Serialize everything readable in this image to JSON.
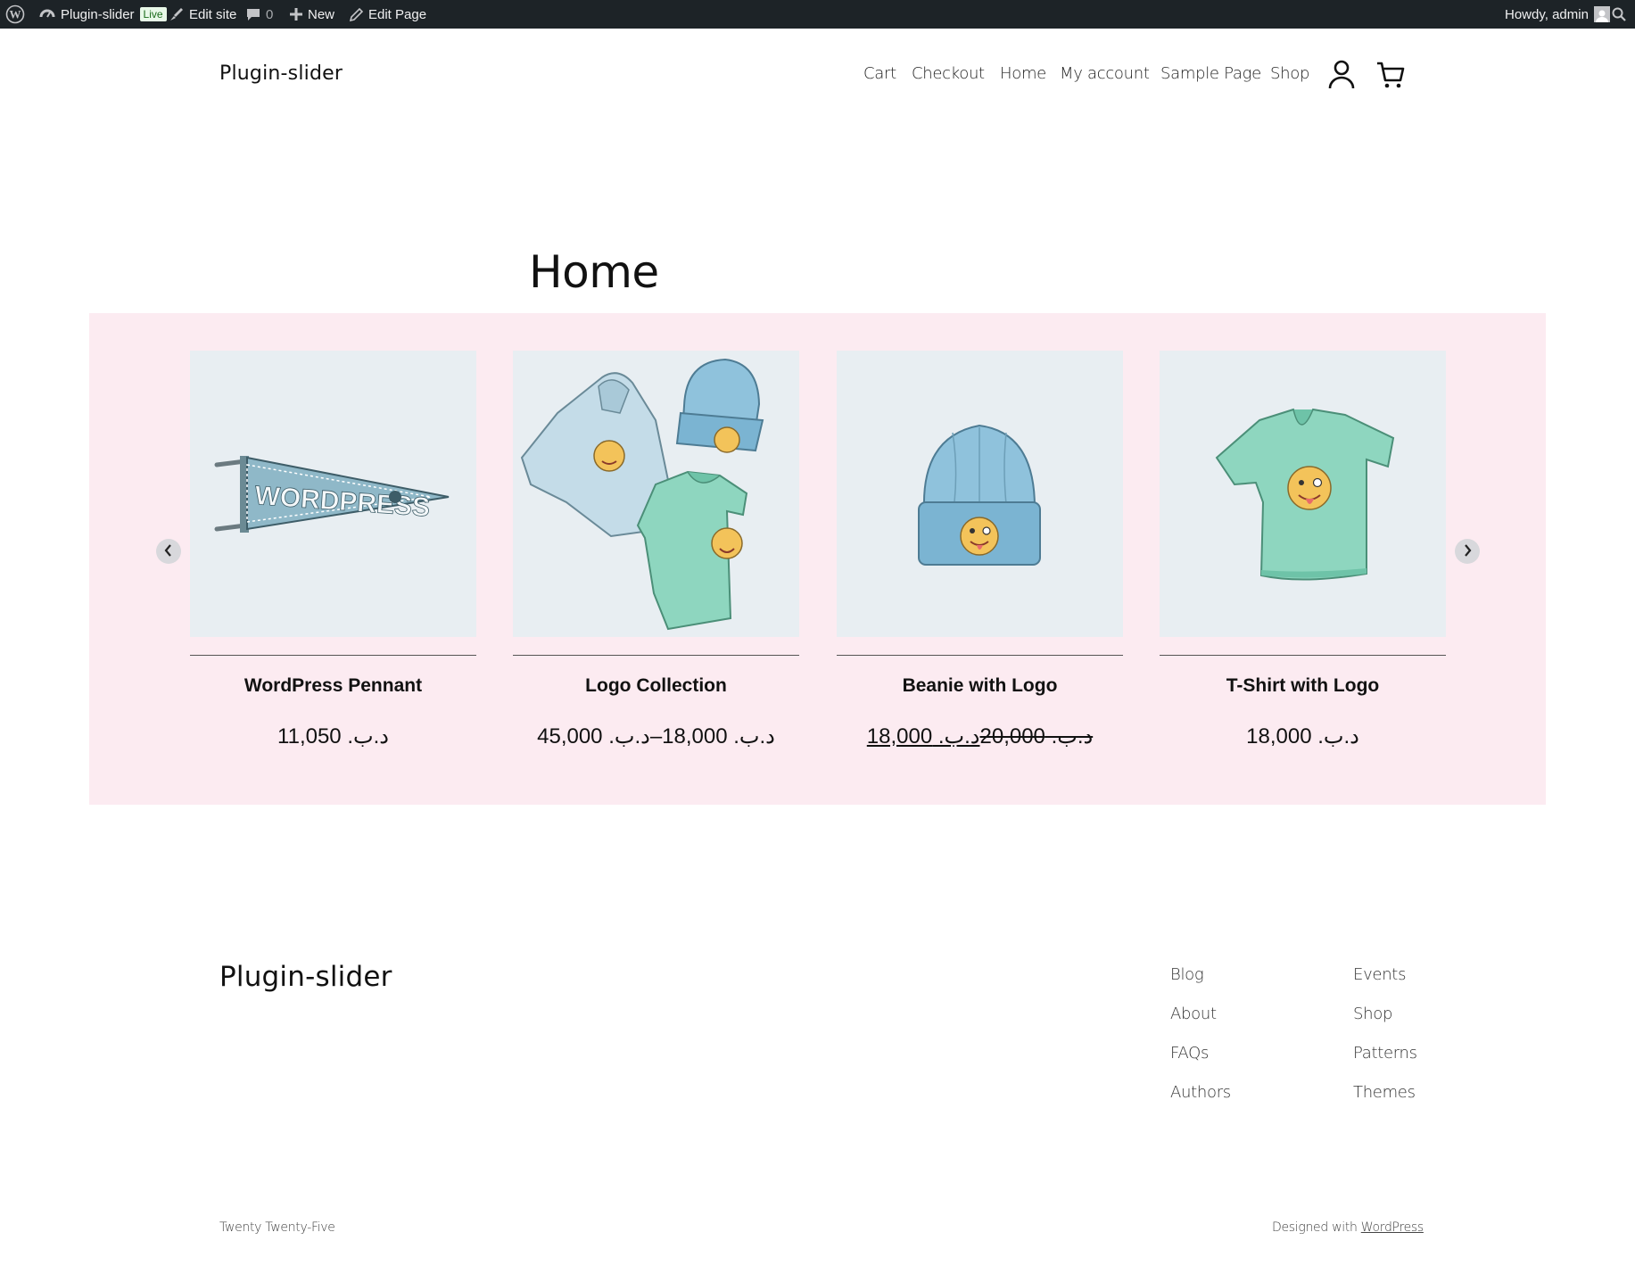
{
  "admin_bar": {
    "site_name": "Plugin-slider",
    "live_badge": "Live",
    "edit_site": "Edit site",
    "comments_count": "0",
    "new_label": "New",
    "edit_page": "Edit Page",
    "howdy": "Howdy, admin"
  },
  "header": {
    "site_title": "Plugin-slider",
    "nav": [
      "Cart",
      "Checkout",
      "Home",
      "My account",
      "Sample Page",
      "Shop"
    ]
  },
  "page": {
    "title": "Home"
  },
  "slider": {
    "background": "#fcebf1",
    "products": [
      {
        "name": "WordPress Pennant",
        "price": "د.ب. 11,050"
      },
      {
        "name": "Logo Collection",
        "price": "د.ب. 18,000–د.ب. 45,000"
      },
      {
        "name": "Beanie with Logo",
        "price_old": "د.ب. 20,000",
        "price_new": "د.ب. 18,000"
      },
      {
        "name": "T-Shirt with Logo",
        "price": "د.ب. 18,000"
      }
    ]
  },
  "footer": {
    "title": "Plugin-slider",
    "col1": [
      "Blog",
      "About",
      "FAQs",
      "Authors"
    ],
    "col2": [
      "Events",
      "Shop",
      "Patterns",
      "Themes"
    ],
    "theme_credit": "Twenty Twenty-Five",
    "designed_with": "Designed with",
    "wordpress_link": "WordPress"
  }
}
